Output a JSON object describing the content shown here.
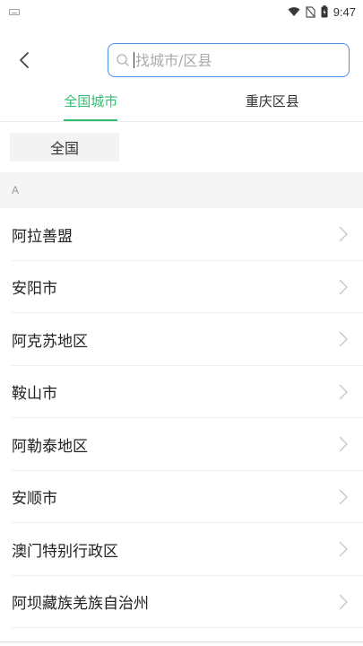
{
  "status_bar": {
    "time": "9:47",
    "icons": [
      "keyboard-icon",
      "wifi-icon",
      "no-sim-icon",
      "battery-icon"
    ]
  },
  "header": {
    "back_icon": "chevron-left-icon",
    "search": {
      "icon": "search-icon",
      "placeholder": "找城市/区县",
      "value": ""
    }
  },
  "tabs": [
    {
      "label": "全国城市",
      "active": true
    },
    {
      "label": "重庆区县",
      "active": false
    }
  ],
  "all_chip": {
    "label": "全国"
  },
  "section": {
    "letter": "A"
  },
  "cities": [
    {
      "name": "阿拉善盟"
    },
    {
      "name": "安阳市"
    },
    {
      "name": "阿克苏地区"
    },
    {
      "name": "鞍山市"
    },
    {
      "name": "阿勒泰地区"
    },
    {
      "name": "安顺市"
    },
    {
      "name": "澳门特别行政区"
    },
    {
      "name": "阿坝藏族羌族自治州"
    }
  ],
  "colors": {
    "accent": "#2fbf71",
    "search_border": "#4a90e2",
    "section_bg": "#f5f5f5"
  }
}
